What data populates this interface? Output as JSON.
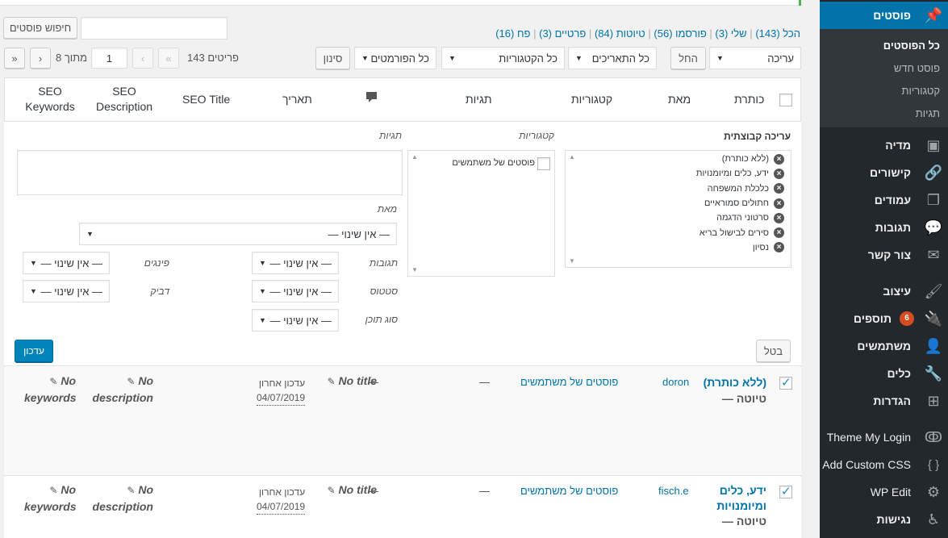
{
  "sidebar": {
    "items": [
      {
        "label": "פוסטים",
        "icon": "pin-icon",
        "glyph": "📌"
      },
      {
        "label": "מדיה",
        "icon": "media-icon",
        "glyph": "🎞"
      },
      {
        "label": "קישורים",
        "icon": "links-icon",
        "glyph": "🔗"
      },
      {
        "label": "עמודים",
        "icon": "pages-icon",
        "glyph": "❐"
      },
      {
        "label": "תגובות",
        "icon": "comments-icon",
        "glyph": "💬"
      },
      {
        "label": "צור קשר",
        "icon": "mail-icon",
        "glyph": "✉"
      },
      {
        "label": "עיצוב",
        "icon": "appearance-icon",
        "glyph": "🖌"
      },
      {
        "label": "תוספים",
        "icon": "plugins-icon",
        "glyph": "🔌",
        "badge": "6"
      },
      {
        "label": "משתמשים",
        "icon": "users-icon",
        "glyph": "👤"
      },
      {
        "label": "כלים",
        "icon": "tools-icon",
        "glyph": "🔧"
      },
      {
        "label": "הגדרות",
        "icon": "settings-icon",
        "glyph": "⊞"
      },
      {
        "label": "Theme My Login",
        "icon": "theme-my-login-icon",
        "glyph": "ↂ"
      },
      {
        "label": "Add Custom CSS",
        "icon": "css-braces-icon",
        "glyph": "{ }"
      },
      {
        "label": "WP Edit",
        "icon": "gear-icon",
        "glyph": "⚙"
      },
      {
        "label": "נגישות",
        "icon": "accessibility-icon",
        "glyph": "♿"
      }
    ],
    "subitems": [
      "כל הפוסטים",
      "פוסט חדש",
      "קטגוריות",
      "תגיות"
    ]
  },
  "status_filters": {
    "all": "הכל (143)",
    "mine": "שלי (3)",
    "published": "פורסמו (56)",
    "drafts": "טיוטות (84)",
    "private": "פרטיים (3)",
    "trash": "פח (16)",
    "sep": "|"
  },
  "search": {
    "button": "חיפוש פוסטים",
    "value": ""
  },
  "toolbar": {
    "bulk": "עריכה",
    "apply": "החל",
    "dates": "כל התאריכים",
    "categories": "כל הקטגוריות",
    "formats": "כל הפורמטים",
    "filter": "סינון",
    "items": "143 פריטים",
    "first": "«",
    "prev": "‹",
    "page": "1",
    "of": "מתוך 8",
    "next": "›",
    "last": "»"
  },
  "columns": {
    "title": "כותרת",
    "author": "מאת",
    "categories": "קטגוריות",
    "tags": "תגיות",
    "comments_icon": "comment-bubble-icon",
    "date": "תאריך",
    "seo_title": "SEO Title",
    "seo_desc": "SEO Description",
    "seo_kw": "SEO Keywords"
  },
  "bulk_edit": {
    "heading": "עריכה קבוצתית",
    "titles": [
      "(ללא כותרת)",
      "ידע, כלים ומיומנויות",
      "כלכלת המשפחה",
      "חתולים סמוראיים",
      "סרטוני הדגמה",
      "סירים לבישול בריא",
      "נסיון"
    ],
    "categories_label": "קטגוריות",
    "category_option": "פוסטים של משתמשים",
    "tags_label": "תגיות",
    "author_label": "מאת",
    "no_change": "— אין שינוי —",
    "comments_label": "תגובות",
    "pings_label": "פינגים",
    "status_label": "סטטוס",
    "sticky_label": "דביק",
    "format_label": "סוג תוכן",
    "cancel": "בטל",
    "update": "עדכון"
  },
  "rows": [
    {
      "title": "(ללא כותרת)",
      "state": "— טיוטה",
      "author": "doron",
      "category": "פוסטים של משתמשים",
      "tags": "—",
      "comments": "—",
      "date_label": "עדכון אחרון",
      "date": "04/07/2019",
      "seo_title": "No title",
      "seo_desc": "No description",
      "seo_kw": "No keywords"
    },
    {
      "title": "ידע, כלים ומיומנויות",
      "state": "— טיוטה",
      "author": "fisch.e",
      "category": "פוסטים של משתמשים",
      "tags": "—",
      "comments": "—",
      "date_label": "עדכון אחרון",
      "date": "04/07/2019",
      "seo_title": "No title",
      "seo_desc": "No description",
      "seo_kw": "No keywords"
    }
  ],
  "colors": {
    "sidebar_bg": "#23282d",
    "accent": "#0073aa",
    "badge": "#d54e21"
  }
}
